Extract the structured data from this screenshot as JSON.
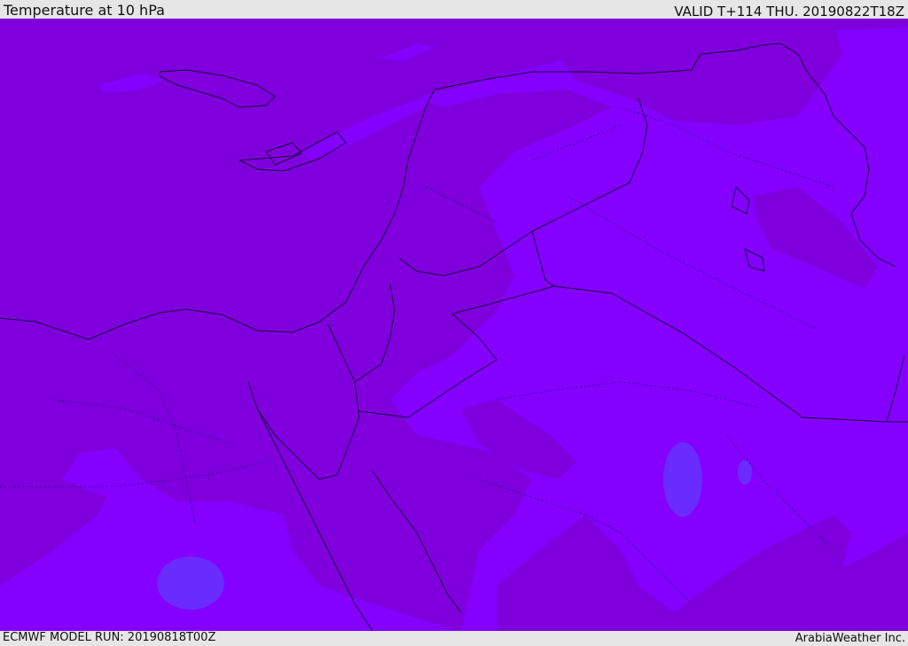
{
  "header": {
    "title": "Temperature at 10 hPa",
    "valid_time": "VALID T+114 THU. 20190822T18Z"
  },
  "footer": {
    "model_run": "ECMWF MODEL RUN: 20190818T00Z",
    "credit": "ArabiaWeather Inc."
  },
  "map": {
    "colors": {
      "base_fill": "#7f00dd",
      "warm_fill": "#8400ff",
      "warmest_fill": "#6a2bff",
      "coastline": "#1a0040",
      "border_dotted": "#3a0090"
    }
  }
}
